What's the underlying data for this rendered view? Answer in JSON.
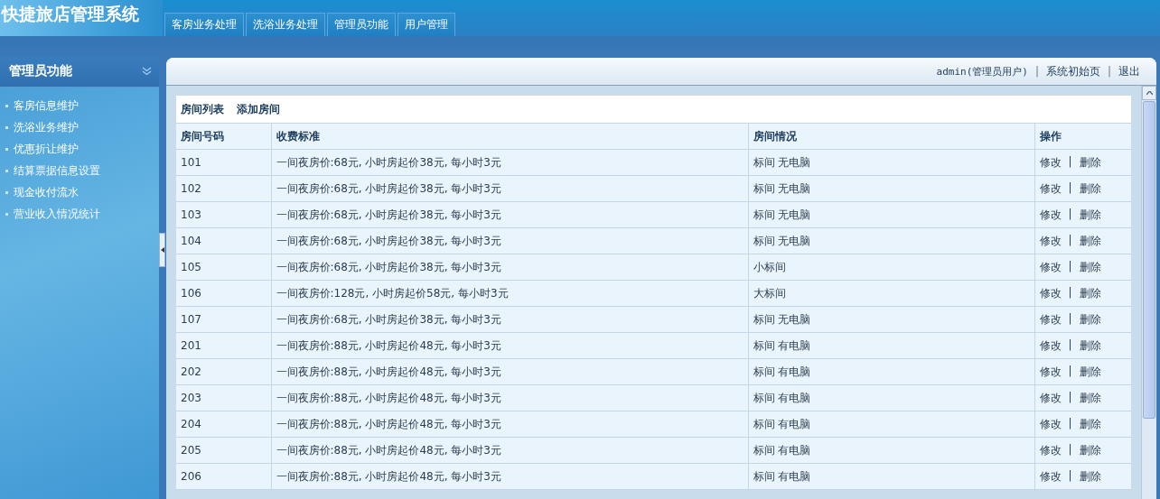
{
  "app_title": "快捷旅店管理系统",
  "tabs": [
    {
      "label": "客房业务处理"
    },
    {
      "label": "洗浴业务处理"
    },
    {
      "label": "管理员功能"
    },
    {
      "label": "用户管理"
    }
  ],
  "sidebar": {
    "title": "管理员功能",
    "items": [
      "客房信息维护",
      "洗浴业务维护",
      "优惠折让维护",
      "结算票据信息设置",
      "现金收付流水",
      "营业收入情况统计"
    ]
  },
  "user_bar": [
    {
      "kind": "text",
      "text": "admin(管理员用户)"
    },
    {
      "kind": "separator",
      "text": "|"
    },
    {
      "kind": "link",
      "text": "系统初始页"
    },
    {
      "kind": "separator",
      "text": "|"
    },
    {
      "kind": "link",
      "text": "退出"
    }
  ],
  "subtabs": [
    "房间列表",
    "添加房间"
  ],
  "table": {
    "columns": [
      "房间号码",
      "收费标准",
      "房间情况",
      "操作"
    ],
    "rows": [
      {
        "number": "101",
        "rate": "一间夜房价:68元, 小时房起价38元, 每小时3元",
        "status": "标间 无电脑",
        "edit": "修改",
        "separator": "|",
        "delete": "删除"
      },
      {
        "number": "102",
        "rate": "一间夜房价:68元, 小时房起价38元, 每小时3元",
        "status": "标间 无电脑",
        "edit": "修改",
        "separator": "|",
        "delete": "删除"
      },
      {
        "number": "103",
        "rate": "一间夜房价:68元, 小时房起价38元, 每小时3元",
        "status": "标间 无电脑",
        "edit": "修改",
        "separator": "|",
        "delete": "删除"
      },
      {
        "number": "104",
        "rate": "一间夜房价:68元, 小时房起价38元, 每小时3元",
        "status": "标间 无电脑",
        "edit": "修改",
        "separator": "|",
        "delete": "删除"
      },
      {
        "number": "105",
        "rate": "一间夜房价:68元, 小时房起价38元, 每小时3元",
        "status": "小标间",
        "edit": "修改",
        "separator": "|",
        "delete": "删除"
      },
      {
        "number": "106",
        "rate": "一间夜房价:128元, 小时房起价58元, 每小时3元",
        "status": "大标间",
        "edit": "修改",
        "separator": "|",
        "delete": "删除"
      },
      {
        "number": "107",
        "rate": "一间夜房价:68元, 小时房起价38元, 每小时3元",
        "status": "标间 无电脑",
        "edit": "修改",
        "separator": "|",
        "delete": "删除"
      },
      {
        "number": "201",
        "rate": "一间夜房价:88元, 小时房起价48元, 每小时3元",
        "status": "标间 有电脑",
        "edit": "修改",
        "separator": "|",
        "delete": "删除"
      },
      {
        "number": "202",
        "rate": "一间夜房价:88元, 小时房起价48元, 每小时3元",
        "status": "标间 有电脑",
        "edit": "修改",
        "separator": "|",
        "delete": "删除"
      },
      {
        "number": "203",
        "rate": "一间夜房价:88元, 小时房起价48元, 每小时3元",
        "status": "标间 有电脑",
        "edit": "修改",
        "separator": "|",
        "delete": "删除"
      },
      {
        "number": "204",
        "rate": "一间夜房价:88元, 小时房起价48元, 每小时3元",
        "status": "标间 有电脑",
        "edit": "修改",
        "separator": "|",
        "delete": "删除"
      },
      {
        "number": "205",
        "rate": "一间夜房价:88元, 小时房起价48元, 每小时3元",
        "status": "标间 有电脑",
        "edit": "修改",
        "separator": "|",
        "delete": "删除"
      },
      {
        "number": "206",
        "rate": "一间夜房价:88元, 小时房起价48元, 每小时3元",
        "status": "标间 有电脑",
        "edit": "修改",
        "separator": "|",
        "delete": "删除"
      }
    ]
  }
}
